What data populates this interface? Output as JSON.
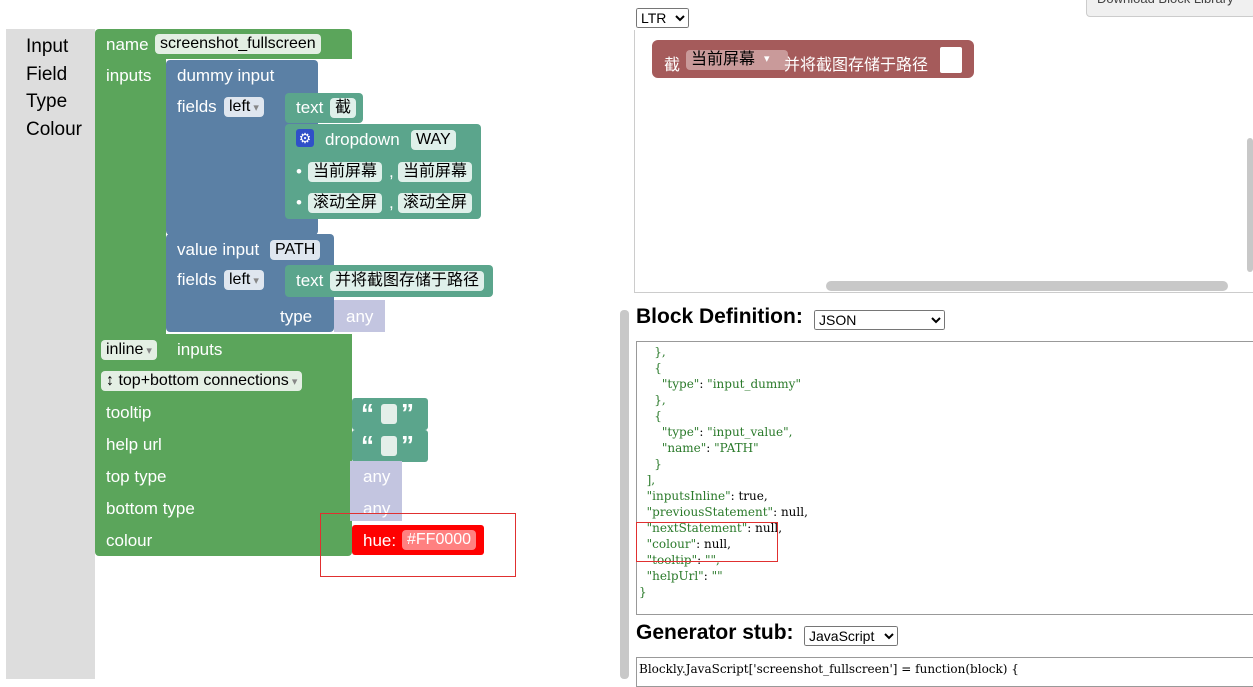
{
  "toolbox": {
    "categories": [
      "Input",
      "Field",
      "Type",
      "Colour"
    ]
  },
  "factory_block": {
    "name_label": "name",
    "name_value": "screenshot_fullscreen",
    "inputs_label": "inputs",
    "dummy_input": {
      "label": "dummy input",
      "fields_label": "fields",
      "align": "left",
      "text_field": {
        "label": "text",
        "value": "截"
      },
      "dropdown_field": {
        "label": "dropdown",
        "name": "WAY",
        "options": [
          {
            "display": "当前屏幕",
            "value": "当前屏幕"
          },
          {
            "display": "滚动全屏",
            "value": "滚动全屏"
          }
        ]
      }
    },
    "value_input": {
      "label": "value input",
      "name": "PATH",
      "fields_label": "fields",
      "align": "left",
      "text_field": {
        "label": "text",
        "value": "并将截图存储于路径"
      },
      "type_label": "type",
      "type_value": "any"
    },
    "inline_value": "inline",
    "inline_label": "inputs",
    "connections": "↕ top+bottom connections",
    "tooltip_label": "tooltip",
    "helpurl_label": "help url",
    "top_type_label": "top type",
    "top_type_value": "any",
    "bottom_type_label": "bottom type",
    "bottom_type_value": "any",
    "colour_label": "colour",
    "hue_label": "hue:",
    "hue_value": "#FF0000",
    "quote_open": "“",
    "quote_close": "”"
  },
  "preview": {
    "direction": "LTR",
    "download_label": "Download Block Library",
    "block_text1": "截",
    "block_dropdown": "当前屏幕",
    "block_text2": "并将截图存储于路径"
  },
  "block_definition": {
    "title": "Block Definition:",
    "format": "JSON",
    "code_lines": [
      "    },",
      "    {",
      "      \"type\": \"input_dummy\"",
      "    },",
      "    {",
      "      \"type\": \"input_value\",",
      "      \"name\": \"PATH\"",
      "    }",
      "  ],",
      "  \"inputsInline\": true,",
      "  \"previousStatement\": null,",
      "  \"nextStatement\": null,",
      "  \"colour\": null,",
      "  \"tooltip\": \"\",",
      "  \"helpUrl\": \"\"",
      "}"
    ]
  },
  "generator_stub": {
    "title": "Generator stub:",
    "language": "JavaScript",
    "code": "Blockly.JavaScript['screenshot_fullscreen'] = function(block) {"
  },
  "colors": {
    "accent": "#5ba55b",
    "hue": "#ff0000",
    "highlight": "#e03030",
    "preview_block": "#a55b5b"
  }
}
